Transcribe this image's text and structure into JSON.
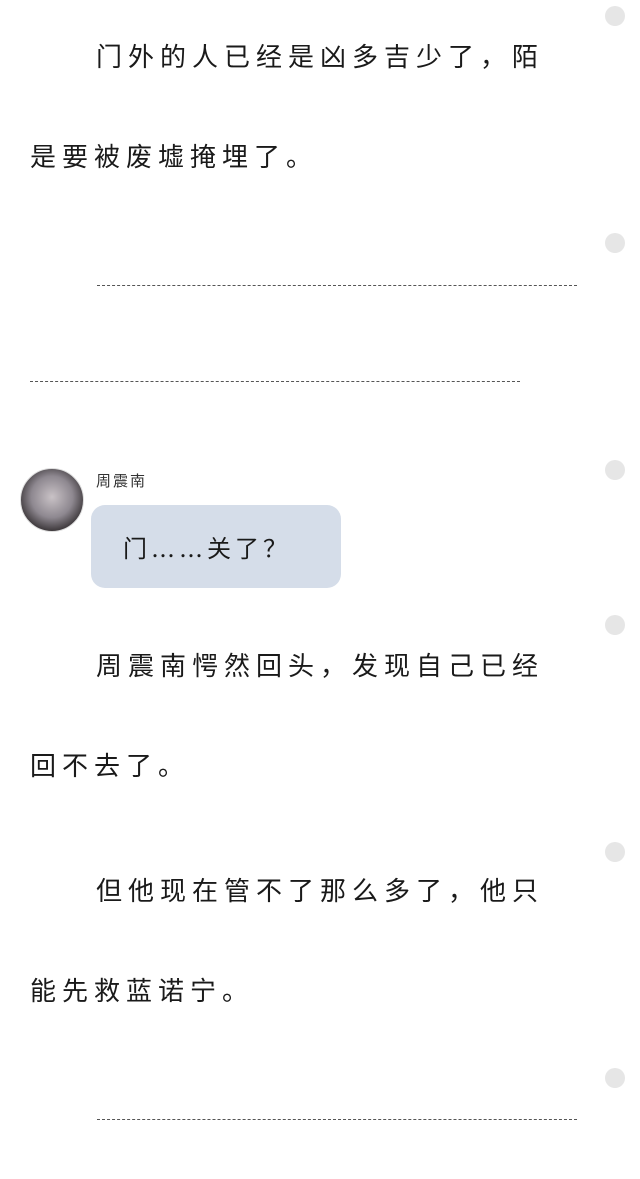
{
  "story": {
    "para1": {
      "line1": "门外的人已经是凶多吉少了，陌",
      "line2": "是要被废墟掩埋了。"
    },
    "para2": {
      "line1": "周震南愕然回头，发现自己已经",
      "line2": "回不去了。"
    },
    "para3": {
      "line1": "但他现在管不了那么多了，他只",
      "line2": "能先救蓝诺宁。"
    }
  },
  "chat": {
    "speaker": "周震南",
    "message": "门……关了？"
  }
}
